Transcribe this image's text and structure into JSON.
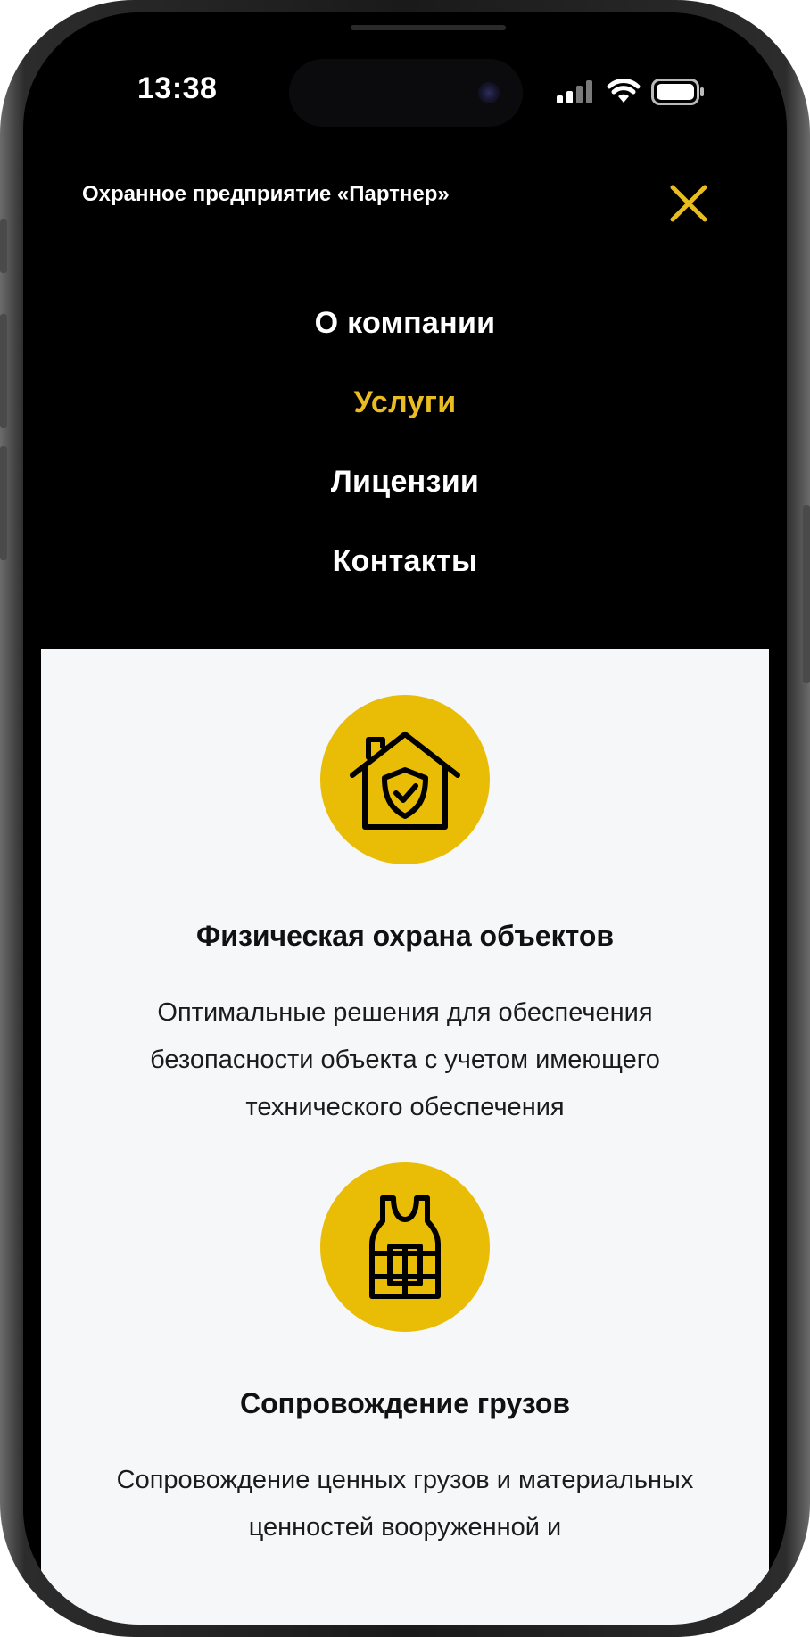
{
  "status_bar": {
    "time": "13:38"
  },
  "header": {
    "brand": "Охранное предприятие «Партнер»",
    "close_icon": "close-icon",
    "accent_color": "#e9bd21"
  },
  "nav": {
    "items": [
      {
        "label": "О компании",
        "active": false
      },
      {
        "label": "Услуги",
        "active": true
      },
      {
        "label": "Лицензии",
        "active": false
      },
      {
        "label": "Контакты",
        "active": false
      }
    ]
  },
  "services": [
    {
      "icon": "house-shield-icon",
      "title": "Физическая охрана объектов",
      "description": "Оптимальные решения для обеспечения безопасности объекта с учетом имеющего технического обеспечения"
    },
    {
      "icon": "body-armor-vest-icon",
      "title": "Сопровождение грузов",
      "description": "Сопровождение ценных грузов и материальных ценностей вооруженной и"
    }
  ],
  "colors": {
    "background": "#000000",
    "card": "#f6f7f9",
    "icon_circle": "#e9bd06"
  }
}
